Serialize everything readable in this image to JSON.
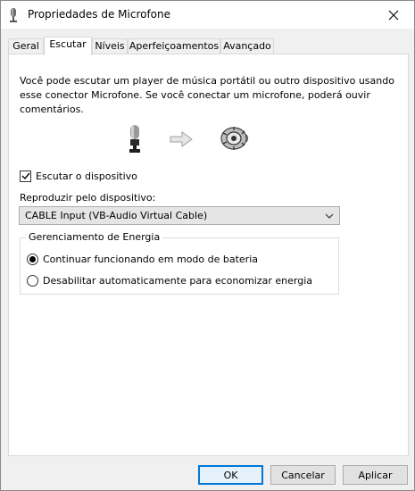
{
  "window": {
    "title": "Propriedades de Microfone"
  },
  "tabs": [
    {
      "label": "Geral",
      "active": false
    },
    {
      "label": "Escutar",
      "active": true
    },
    {
      "label": "Níveis",
      "active": false
    },
    {
      "label": "Aperfeiçoamentos",
      "active": false
    },
    {
      "label": "Avançado",
      "active": false
    }
  ],
  "listen": {
    "description": "Você pode escutar um player de música portátil ou outro dispositivo usando esse conector Microfone. Se você conectar um microfone, poderá ouvir comentários.",
    "icons": [
      "microphone-icon",
      "arrow-right-icon",
      "speaker-icon"
    ],
    "checkbox_label": "Escutar o dispositivo",
    "checkbox_checked": true,
    "playback_label": "Reproduzir pelo dispositivo:",
    "playback_value": "CABLE Input (VB-Audio Virtual Cable)"
  },
  "power": {
    "title": "Gerenciamento de Energia",
    "options": [
      {
        "label": "Continuar funcionando em modo de bateria",
        "selected": true
      },
      {
        "label": "Desabilitar automaticamente para economizar energia",
        "selected": false
      }
    ]
  },
  "buttons": {
    "ok": "OK",
    "cancel": "Cancelar",
    "apply": "Aplicar"
  },
  "colors": {
    "accent": "#0078d7",
    "panel": "#ffffff",
    "window": "#f0f0f0"
  }
}
